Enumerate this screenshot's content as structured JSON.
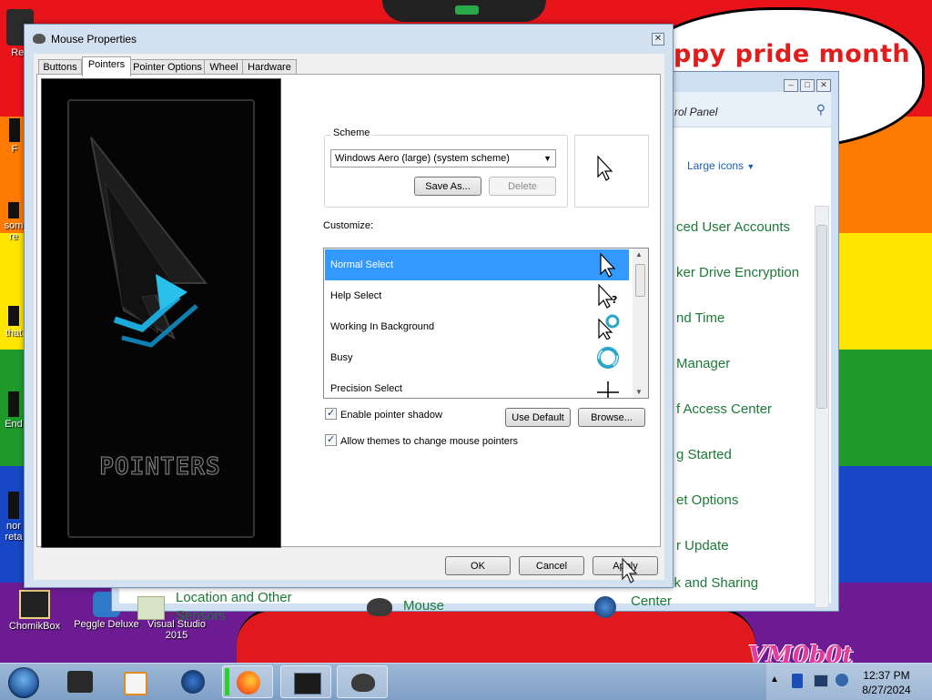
{
  "desktop": {
    "banner_text": "ppy pride month",
    "watermark": "VM0b0t",
    "icons": [
      {
        "label": "Rec"
      },
      {
        "label": "F"
      },
      {
        "label": "som"
      },
      {
        "label": "re"
      },
      {
        "label": "that"
      },
      {
        "label": "End"
      },
      {
        "label": "nor"
      },
      {
        "label": "reta"
      },
      {
        "label": "ChomikBox"
      },
      {
        "label": "Peggle Deluxe"
      },
      {
        "label": "Visual Studio 2015"
      }
    ]
  },
  "control_panel": {
    "address_text": "rol Panel",
    "view_by": "Large icons",
    "items": [
      "ced User Accounts",
      "ker Drive Encryption",
      "nd Time",
      " Manager",
      "f Access Center",
      "g Started",
      "et Options",
      "r Update",
      "Network and Sharing Center"
    ],
    "bottom_items": [
      "Location and Other Sensors",
      "Mouse"
    ]
  },
  "dialog": {
    "title": "Mouse Properties",
    "close_label": "✕",
    "tabs": [
      "Buttons",
      "Pointers",
      "Pointer Options",
      "Wheel",
      "Hardware"
    ],
    "active_tab": "Pointers",
    "art_caption": "POINTERS",
    "scheme": {
      "legend": "Scheme",
      "value": "Windows Aero (large) (system scheme)",
      "save_as": "Save As...",
      "delete": "Delete"
    },
    "customize_label": "Customize:",
    "pointer_rows": [
      {
        "label": "Normal Select",
        "icon": "arrow-icon",
        "selected": true
      },
      {
        "label": "Help Select",
        "icon": "help-arrow-icon",
        "selected": false
      },
      {
        "label": "Working In Background",
        "icon": "working-icon",
        "selected": false
      },
      {
        "label": "Busy",
        "icon": "busy-ring-icon",
        "selected": false
      },
      {
        "label": "Precision Select",
        "icon": "crosshair-icon",
        "selected": false
      }
    ],
    "enable_shadow": {
      "label": "Enable pointer shadow",
      "checked": true
    },
    "allow_themes": {
      "label": "Allow themes to change mouse pointers",
      "checked": true
    },
    "use_default": "Use Default",
    "browse": "Browse...",
    "ok": "OK",
    "cancel": "Cancel",
    "apply": "Apply"
  },
  "taskbar": {
    "time": "12:37 PM",
    "date": "8/27/2024"
  },
  "colors": {
    "selection": "#3399ff",
    "link_green": "#1c7a38",
    "pride_red": "#e01c1c"
  }
}
